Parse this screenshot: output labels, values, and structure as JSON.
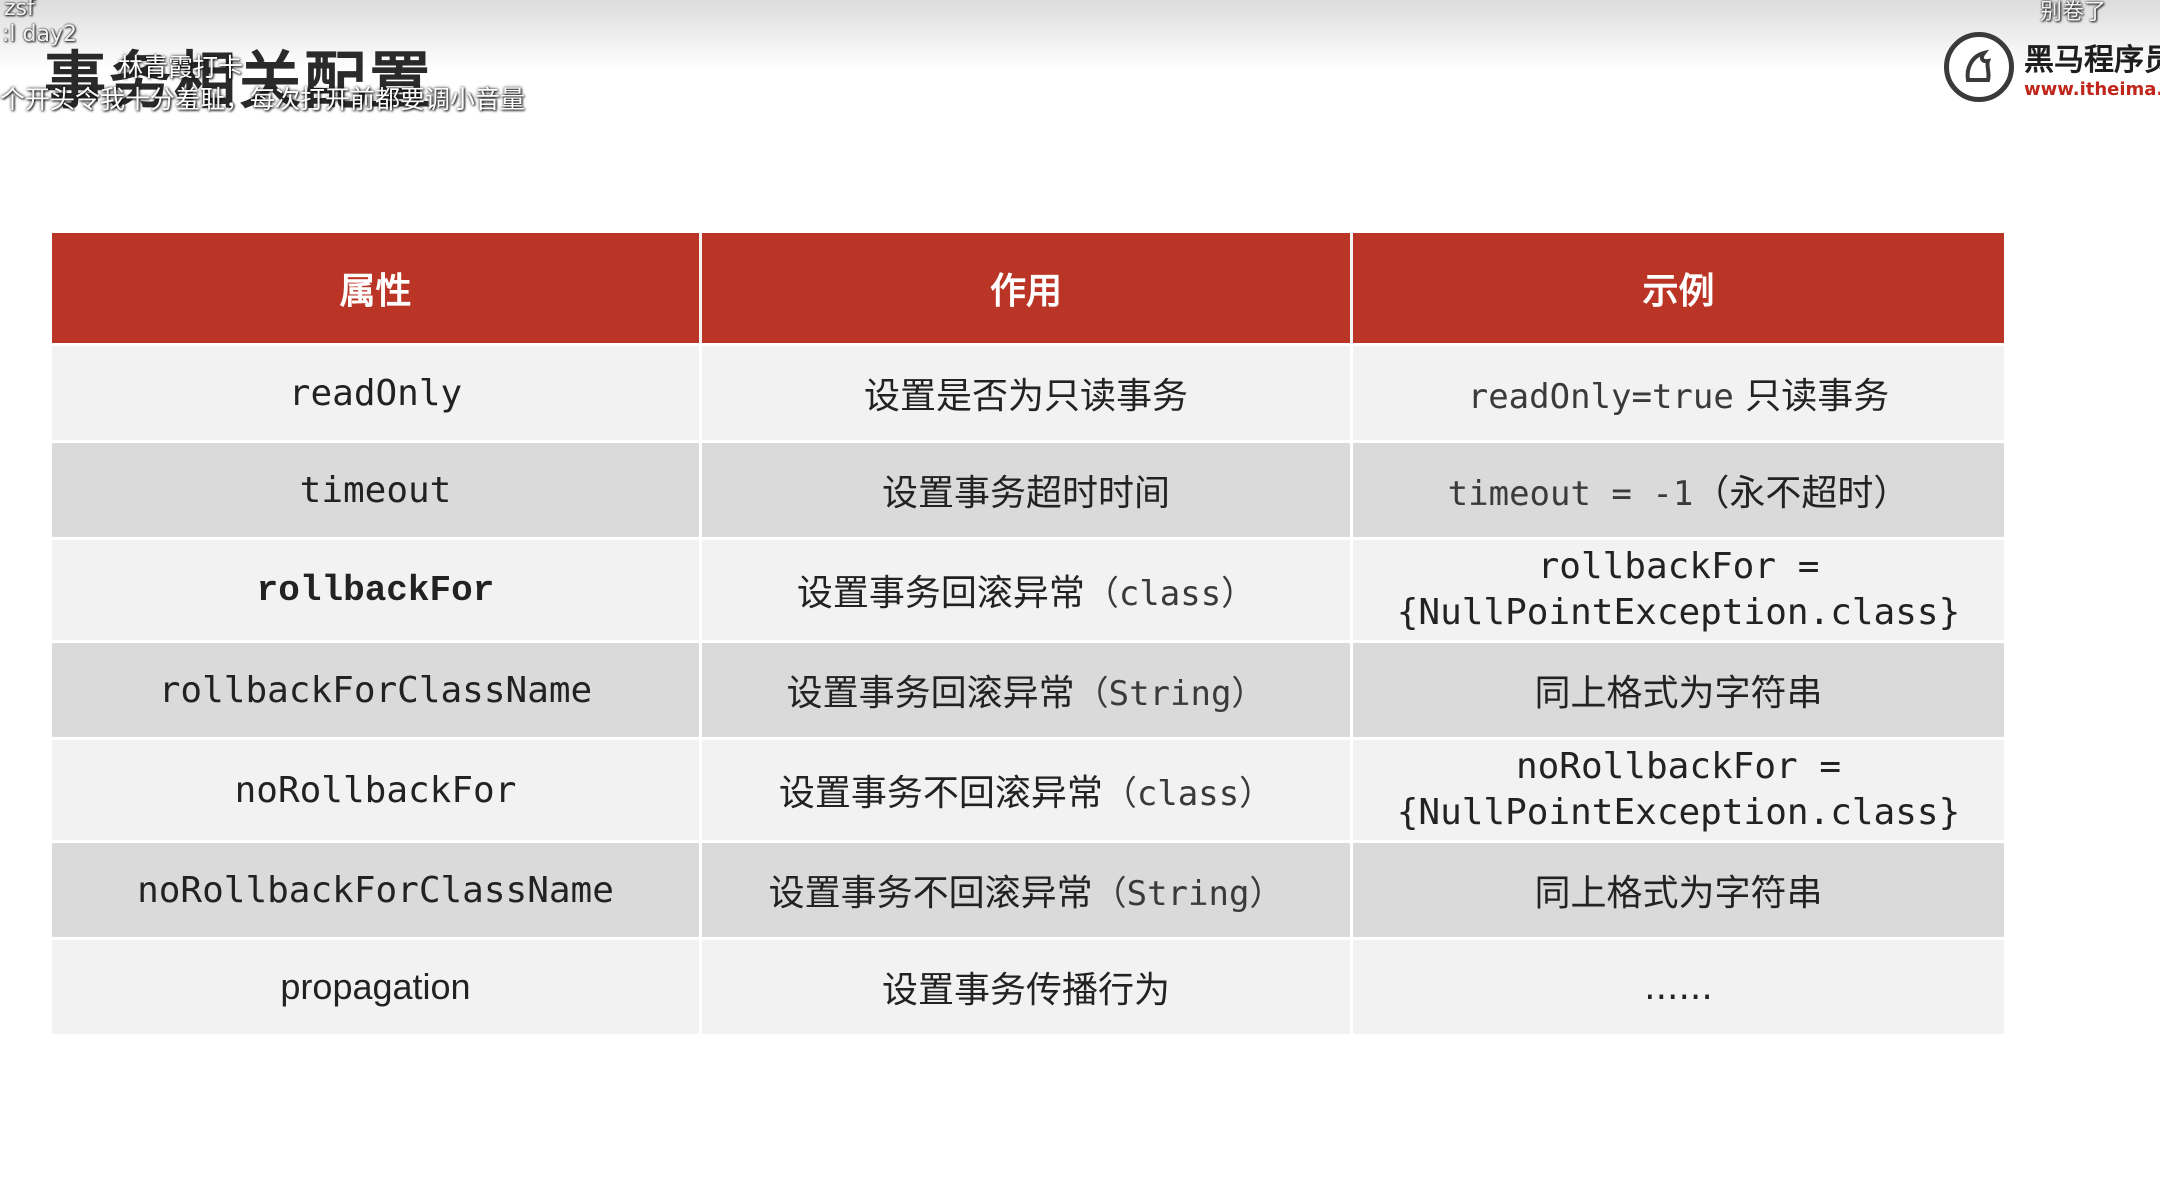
{
  "overlay": {
    "user": "zsf",
    "episode": ":l  day2",
    "commenter": "林青霞打卡",
    "danmu": "个开头令我十分羞耻，每次打开前都要调小音量",
    "top_right": "别卷了"
  },
  "slide": {
    "title": "事务相关配置"
  },
  "logo": {
    "name": "黑马程序员",
    "url": "www.itheima.com"
  },
  "table": {
    "headers": [
      "属性",
      "作用",
      "示例"
    ],
    "rows": [
      {
        "attr": "readOnly",
        "effect": "设置是否为只读事务",
        "example_code": "readOnly=true",
        "example_text": " 只读事务"
      },
      {
        "attr": "timeout",
        "effect": "设置事务超时时间",
        "example_code": "timeout = -1",
        "example_text": "（永不超时）"
      },
      {
        "attr": "rollbackFor",
        "effect_text": "设置事务回滚异常",
        "effect_code": "（class）",
        "example_line1": "rollbackFor =",
        "example_line2": "{NullPointException.class}"
      },
      {
        "attr": "rollbackForClassName",
        "effect_text": "设置事务回滚异常",
        "effect_code": "（String）",
        "example": "同上格式为字符串"
      },
      {
        "attr": "noRollbackFor",
        "effect_text": "设置事务不回滚异常",
        "effect_code": "（class）",
        "example_line1": "noRollbackFor =",
        "example_line2": "{NullPointException.class}"
      },
      {
        "attr": "noRollbackForClassName",
        "effect_text": "设置事务不回滚异常",
        "effect_code": "（String）",
        "example": "同上格式为字符串"
      },
      {
        "attr": "propagation",
        "effect": "设置事务传播行为",
        "example": "......"
      }
    ]
  },
  "colors": {
    "header_bg": "#bb3526",
    "highlight_text": "#b52d1f"
  }
}
